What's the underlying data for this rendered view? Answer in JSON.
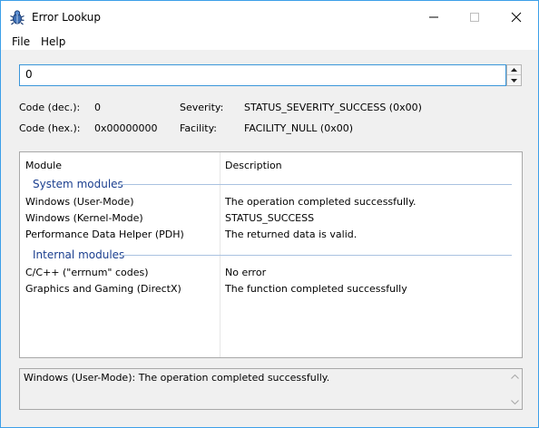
{
  "window": {
    "title": "Error Lookup",
    "icon": "bug-icon",
    "controls": {
      "minimize": "minimize-icon",
      "maximize": "maximize-icon",
      "close": "close-icon"
    }
  },
  "menu": {
    "file": "File",
    "help": "Help"
  },
  "input": {
    "value": "0"
  },
  "info": {
    "code_dec_label": "Code (dec.):",
    "code_dec_value": "0",
    "code_hex_label": "Code (hex.):",
    "code_hex_value": "0x00000000",
    "severity_label": "Severity:",
    "severity_value": "STATUS_SEVERITY_SUCCESS (0x00)",
    "facility_label": "Facility:",
    "facility_value": "FACILITY_NULL (0x00)"
  },
  "list": {
    "columns": [
      "Module",
      "Description"
    ],
    "groups": [
      {
        "name": "System modules",
        "rows": [
          {
            "module": "Windows (User-Mode)",
            "description": "The operation completed successfully."
          },
          {
            "module": "Windows (Kernel-Mode)",
            "description": "STATUS_SUCCESS"
          },
          {
            "module": "Performance Data Helper (PDH)",
            "description": "The returned data is valid."
          }
        ]
      },
      {
        "name": "Internal modules",
        "rows": [
          {
            "module": "C/C++ (\"errnum\" codes)",
            "description": "No error"
          },
          {
            "module": "Graphics and Gaming (DirectX)",
            "description": "The function completed successfully"
          }
        ]
      }
    ]
  },
  "detail": {
    "text": "Windows (User-Mode): The operation completed successfully."
  },
  "colors": {
    "accent": "#3c9fe8",
    "group_text": "#1b3f8f",
    "group_rule": "#a9c2e0"
  }
}
